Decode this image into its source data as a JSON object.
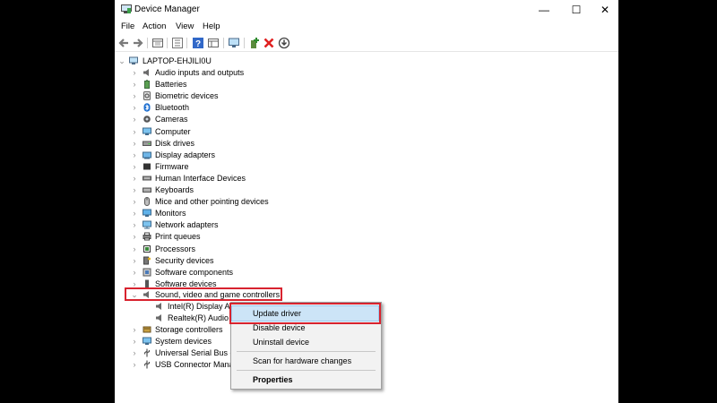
{
  "window": {
    "title": "Device Manager",
    "minimize": "—",
    "maximize": "☐",
    "close": "✕"
  },
  "menu": {
    "file": "File",
    "action": "Action",
    "view": "View",
    "help": "Help"
  },
  "toolbar": {
    "icons": [
      "back-arrow-icon",
      "forward-arrow-icon",
      "properties-pane-icon",
      "list-view-icon",
      "help-icon",
      "console-view-icon",
      "monitor-scan-icon",
      "add-driver-icon",
      "uninstall-x-icon",
      "download-update-icon"
    ]
  },
  "tree": {
    "root": "LAPTOP-EHJILI0U",
    "categories": [
      {
        "label": "Audio inputs and outputs",
        "icon": "speaker-icon"
      },
      {
        "label": "Batteries",
        "icon": "battery-icon"
      },
      {
        "label": "Biometric devices",
        "icon": "fingerprint-icon"
      },
      {
        "label": "Bluetooth",
        "icon": "bluetooth-icon"
      },
      {
        "label": "Cameras",
        "icon": "camera-icon"
      },
      {
        "label": "Computer",
        "icon": "computer-icon"
      },
      {
        "label": "Disk drives",
        "icon": "disk-drive-icon"
      },
      {
        "label": "Display adapters",
        "icon": "display-adapter-icon"
      },
      {
        "label": "Firmware",
        "icon": "firmware-icon"
      },
      {
        "label": "Human Interface Devices",
        "icon": "hid-icon"
      },
      {
        "label": "Keyboards",
        "icon": "keyboard-icon"
      },
      {
        "label": "Mice and other pointing devices",
        "icon": "mouse-icon"
      },
      {
        "label": "Monitors",
        "icon": "monitor-icon"
      },
      {
        "label": "Network adapters",
        "icon": "network-adapter-icon"
      },
      {
        "label": "Print queues",
        "icon": "printer-icon"
      },
      {
        "label": "Processors",
        "icon": "processor-icon"
      },
      {
        "label": "Security devices",
        "icon": "security-key-icon"
      },
      {
        "label": "Software components",
        "icon": "software-component-icon"
      },
      {
        "label": "Software devices",
        "icon": "software-device-icon"
      }
    ],
    "sound": {
      "label": "Sound, video and game controllers",
      "children": [
        "Intel(R) Display Au",
        "Realtek(R) Audio"
      ]
    },
    "after": [
      {
        "label": "Storage controllers",
        "icon": "storage-icon"
      },
      {
        "label": "System devices",
        "icon": "system-device-icon"
      },
      {
        "label": "Universal Serial Bus co",
        "icon": "usb-icon"
      },
      {
        "label": "USB Connector Mana",
        "icon": "usb-connector-icon"
      }
    ]
  },
  "context_menu": {
    "update": "Update driver",
    "disable": "Disable device",
    "uninstall": "Uninstall device",
    "scan": "Scan for hardware changes",
    "properties": "Properties"
  },
  "colors": {
    "highlight_red": "#d8232f",
    "menu_hover": "#cce4f7"
  }
}
